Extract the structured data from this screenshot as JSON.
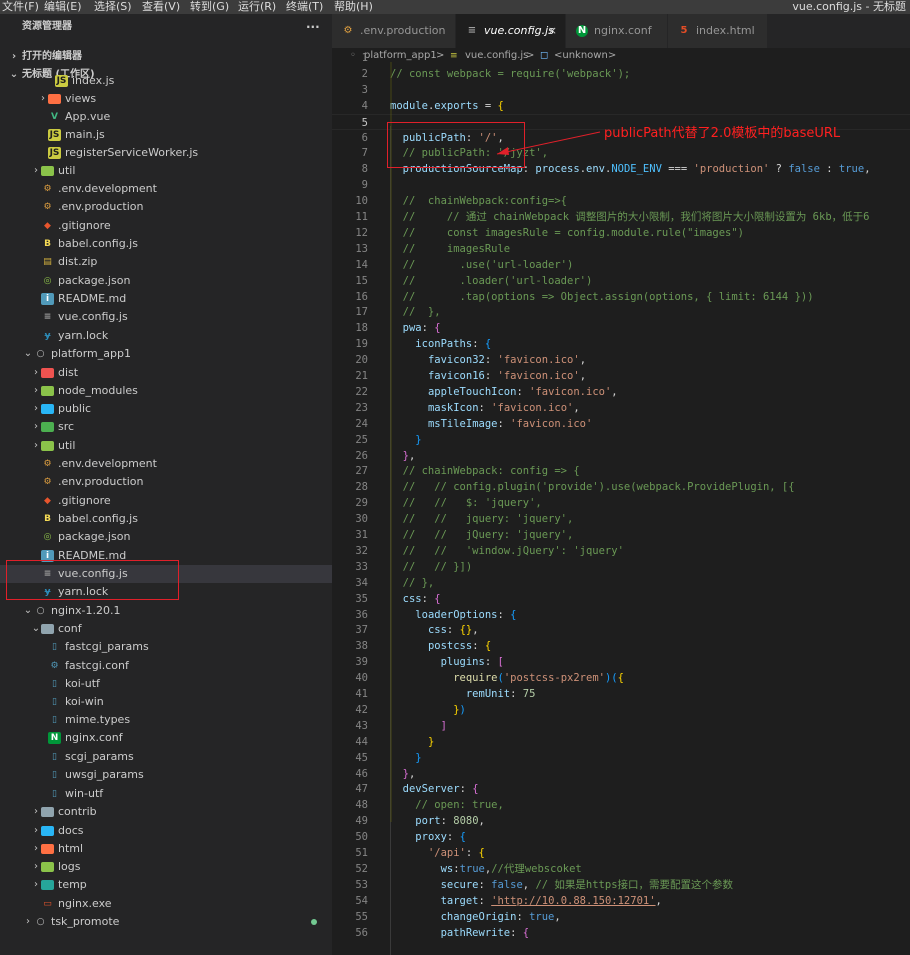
{
  "menu": [
    "文件(F)",
    "编辑(E)",
    "选择(S)",
    "查看(V)",
    "转到(G)",
    "运行(R)",
    "终端(T)",
    "帮助(H)"
  ],
  "window_title": "vue.config.js - 无标题",
  "sidebar": {
    "title": "资源管理器",
    "more": "···",
    "open_editors": "打开的编辑器",
    "workspace": "无标题 (工作区)"
  },
  "tree": [
    {
      "label": "index.js",
      "icon": "js",
      "depth": 4
    },
    {
      "label": "views",
      "icon": "folder-views",
      "depth": 3,
      "twisty": "closed"
    },
    {
      "label": "App.vue",
      "icon": "vue",
      "depth": 3
    },
    {
      "label": "main.js",
      "icon": "js",
      "depth": 3
    },
    {
      "label": "registerServiceWorker.js",
      "icon": "js",
      "depth": 3
    },
    {
      "label": "util",
      "icon": "folder-util",
      "depth": 2,
      "twisty": "closed"
    },
    {
      "label": ".env.development",
      "icon": "env",
      "depth": 2
    },
    {
      "label": ".env.production",
      "icon": "env",
      "depth": 2
    },
    {
      "label": ".gitignore",
      "icon": "git",
      "depth": 2
    },
    {
      "label": "babel.config.js",
      "icon": "babel",
      "depth": 2
    },
    {
      "label": "dist.zip",
      "icon": "zip",
      "depth": 2
    },
    {
      "label": "package.json",
      "icon": "npm",
      "depth": 2
    },
    {
      "label": "README.md",
      "icon": "info",
      "depth": 2
    },
    {
      "label": "vue.config.js",
      "icon": "config",
      "depth": 2
    },
    {
      "label": "yarn.lock",
      "icon": "yarn",
      "depth": 2
    },
    {
      "label": "platform_app1",
      "icon": "root",
      "depth": 1,
      "twisty": "open"
    },
    {
      "label": "dist",
      "icon": "folder-dist",
      "depth": 2,
      "twisty": "closed"
    },
    {
      "label": "node_modules",
      "icon": "folder-node",
      "depth": 2,
      "twisty": "closed"
    },
    {
      "label": "public",
      "icon": "folder-public",
      "depth": 2,
      "twisty": "closed"
    },
    {
      "label": "src",
      "icon": "folder-src",
      "depth": 2,
      "twisty": "closed"
    },
    {
      "label": "util",
      "icon": "folder-util",
      "depth": 2,
      "twisty": "closed"
    },
    {
      "label": ".env.development",
      "icon": "env",
      "depth": 2
    },
    {
      "label": ".env.production",
      "icon": "env",
      "depth": 2
    },
    {
      "label": ".gitignore",
      "icon": "git",
      "depth": 2
    },
    {
      "label": "babel.config.js",
      "icon": "babel",
      "depth": 2
    },
    {
      "label": "package.json",
      "icon": "npm",
      "depth": 2
    },
    {
      "label": "README.md",
      "icon": "info",
      "depth": 2
    },
    {
      "label": "vue.config.js",
      "icon": "config",
      "depth": 2,
      "selected": true
    },
    {
      "label": "yarn.lock",
      "icon": "yarn",
      "depth": 2
    },
    {
      "label": "nginx-1.20.1",
      "icon": "root",
      "depth": 1,
      "twisty": "open"
    },
    {
      "label": "conf",
      "icon": "folder-open",
      "depth": 2,
      "twisty": "open"
    },
    {
      "label": "fastcgi_params",
      "icon": "file",
      "depth": 3
    },
    {
      "label": "fastcgi.conf",
      "icon": "gear",
      "depth": 3
    },
    {
      "label": "koi-utf",
      "icon": "file",
      "depth": 3
    },
    {
      "label": "koi-win",
      "icon": "file",
      "depth": 3
    },
    {
      "label": "mime.types",
      "icon": "file",
      "depth": 3
    },
    {
      "label": "nginx.conf",
      "icon": "nginx",
      "depth": 3
    },
    {
      "label": "scgi_params",
      "icon": "file",
      "depth": 3
    },
    {
      "label": "uwsgi_params",
      "icon": "file",
      "depth": 3
    },
    {
      "label": "win-utf",
      "icon": "file",
      "depth": 3
    },
    {
      "label": "contrib",
      "icon": "folder",
      "depth": 2,
      "twisty": "closed"
    },
    {
      "label": "docs",
      "icon": "folder-docs",
      "depth": 2,
      "twisty": "closed"
    },
    {
      "label": "html",
      "icon": "folder-html",
      "depth": 2,
      "twisty": "closed"
    },
    {
      "label": "logs",
      "icon": "folder-logs",
      "depth": 2,
      "twisty": "closed"
    },
    {
      "label": "temp",
      "icon": "folder-temp",
      "depth": 2,
      "twisty": "closed"
    },
    {
      "label": "nginx.exe",
      "icon": "exe",
      "depth": 2
    },
    {
      "label": "tsk_promote",
      "icon": "root",
      "depth": 1,
      "twisty": "closed",
      "dot": true
    }
  ],
  "tabs": [
    {
      "label": ".env.production",
      "icon": "env",
      "active": false
    },
    {
      "label": "vue.config.js",
      "icon": "config",
      "active": true,
      "close": "×"
    },
    {
      "label": "nginx.conf",
      "icon": "nginx",
      "active": false
    },
    {
      "label": "index.html",
      "icon": "html",
      "active": false
    }
  ],
  "breadcrumb": {
    "folder": "platform_app1",
    "sep": ">",
    "file": "vue.config.js",
    "symbol": "<unknown>"
  },
  "annotation": "publicPath代替了2.0模板中的baseURL",
  "code": [
    [],
    [
      [
        "cm",
        "// const webpack = require('webpack');"
      ]
    ],
    [],
    [
      [
        "pr",
        "module"
      ],
      [
        "ops",
        "."
      ],
      [
        "pr",
        "exports"
      ],
      [
        "ops",
        " = "
      ],
      [
        "br",
        "{"
      ]
    ],
    [],
    [
      [
        "ops",
        "  "
      ],
      [
        "pr",
        "publicPath"
      ],
      [
        "ops",
        ": "
      ],
      [
        "st",
        "'/'"
      ],
      [
        "ops",
        ","
      ]
    ],
    [
      [
        "cm",
        "  // publicPath: '/jyzt',"
      ]
    ],
    [
      [
        "ops",
        "  "
      ],
      [
        "pr",
        "productionSourceMap"
      ],
      [
        "ops",
        ": "
      ],
      [
        "pr",
        "process"
      ],
      [
        "ops",
        "."
      ],
      [
        "pr",
        "env"
      ],
      [
        "ops",
        "."
      ],
      [
        "ct2",
        "NODE_ENV"
      ],
      [
        "ops",
        " === "
      ],
      [
        "st",
        "'production'"
      ],
      [
        "ops",
        " ? "
      ],
      [
        "kw",
        "false"
      ],
      [
        "ops",
        " : "
      ],
      [
        "kw",
        "true"
      ],
      [
        "ops",
        ","
      ]
    ],
    [],
    [
      [
        "cm",
        "  //  chainWebpack:config=>{"
      ]
    ],
    [
      [
        "cm",
        "  //     // 通过 chainWebpack 调整图片的大小限制，我们将图片大小限制设置为 6kb，低于6"
      ]
    ],
    [
      [
        "cm",
        "  //     const imagesRule = config.module.rule(\"images\")"
      ]
    ],
    [
      [
        "cm",
        "  //     imagesRule"
      ]
    ],
    [
      [
        "cm",
        "  //       .use('url-loader')"
      ]
    ],
    [
      [
        "cm",
        "  //       .loader('url-loader')"
      ]
    ],
    [
      [
        "cm",
        "  //       .tap(options => Object.assign(options, { limit: 6144 }))"
      ]
    ],
    [
      [
        "cm",
        "  //  },"
      ]
    ],
    [
      [
        "ops",
        "  "
      ],
      [
        "pr",
        "pwa"
      ],
      [
        "ops",
        ": "
      ],
      [
        "br2",
        "{"
      ]
    ],
    [
      [
        "ops",
        "    "
      ],
      [
        "pr",
        "iconPaths"
      ],
      [
        "ops",
        ": "
      ],
      [
        "br3",
        "{"
      ]
    ],
    [
      [
        "ops",
        "      "
      ],
      [
        "pr",
        "favicon32"
      ],
      [
        "ops",
        ": "
      ],
      [
        "st",
        "'favicon.ico'"
      ],
      [
        "ops",
        ","
      ]
    ],
    [
      [
        "ops",
        "      "
      ],
      [
        "pr",
        "favicon16"
      ],
      [
        "ops",
        ": "
      ],
      [
        "st",
        "'favicon.ico'"
      ],
      [
        "ops",
        ","
      ]
    ],
    [
      [
        "ops",
        "      "
      ],
      [
        "pr",
        "appleTouchIcon"
      ],
      [
        "ops",
        ": "
      ],
      [
        "st",
        "'favicon.ico'"
      ],
      [
        "ops",
        ","
      ]
    ],
    [
      [
        "ops",
        "      "
      ],
      [
        "pr",
        "maskIcon"
      ],
      [
        "ops",
        ": "
      ],
      [
        "st",
        "'favicon.ico'"
      ],
      [
        "ops",
        ","
      ]
    ],
    [
      [
        "ops",
        "      "
      ],
      [
        "pr",
        "msTileImage"
      ],
      [
        "ops",
        ": "
      ],
      [
        "st",
        "'favicon.ico'"
      ]
    ],
    [
      [
        "ops",
        "    "
      ],
      [
        "br3",
        "}"
      ]
    ],
    [
      [
        "ops",
        "  "
      ],
      [
        "br2",
        "}"
      ],
      [
        "ops",
        ","
      ]
    ],
    [
      [
        "cm",
        "  // chainWebpack: config => {"
      ]
    ],
    [
      [
        "cm",
        "  //   // config.plugin('provide').use(webpack.ProvidePlugin, [{"
      ]
    ],
    [
      [
        "cm",
        "  //   //   $: 'jquery',"
      ]
    ],
    [
      [
        "cm",
        "  //   //   jquery: 'jquery',"
      ]
    ],
    [
      [
        "cm",
        "  //   //   jQuery: 'jquery',"
      ]
    ],
    [
      [
        "cm",
        "  //   //   'window.jQuery': 'jquery'"
      ]
    ],
    [
      [
        "cm",
        "  //   // }])"
      ]
    ],
    [
      [
        "cm",
        "  // },"
      ]
    ],
    [
      [
        "ops",
        "  "
      ],
      [
        "pr",
        "css"
      ],
      [
        "ops",
        ": "
      ],
      [
        "br2",
        "{"
      ]
    ],
    [
      [
        "ops",
        "    "
      ],
      [
        "pr",
        "loaderOptions"
      ],
      [
        "ops",
        ": "
      ],
      [
        "br3",
        "{"
      ]
    ],
    [
      [
        "ops",
        "      "
      ],
      [
        "pr",
        "css"
      ],
      [
        "ops",
        ": "
      ],
      [
        "br",
        "{}"
      ],
      [
        "ops",
        ","
      ]
    ],
    [
      [
        "ops",
        "      "
      ],
      [
        "pr",
        "postcss"
      ],
      [
        "ops",
        ": "
      ],
      [
        "br",
        "{"
      ]
    ],
    [
      [
        "ops",
        "        "
      ],
      [
        "pr",
        "plugins"
      ],
      [
        "ops",
        ": "
      ],
      [
        "br2",
        "["
      ]
    ],
    [
      [
        "ops",
        "          "
      ],
      [
        "fn",
        "require"
      ],
      [
        "br3",
        "("
      ],
      [
        "st",
        "'postcss-px2rem'"
      ],
      [
        "br3",
        ")"
      ],
      [
        "br3",
        "("
      ],
      [
        "br",
        "{"
      ]
    ],
    [
      [
        "ops",
        "            "
      ],
      [
        "pr",
        "remUnit"
      ],
      [
        "ops",
        ": "
      ],
      [
        "nm",
        "75"
      ]
    ],
    [
      [
        "ops",
        "          "
      ],
      [
        "br",
        "}"
      ],
      [
        "br3",
        ")"
      ]
    ],
    [
      [
        "ops",
        "        "
      ],
      [
        "br2",
        "]"
      ]
    ],
    [
      [
        "ops",
        "      "
      ],
      [
        "br",
        "}"
      ]
    ],
    [
      [
        "ops",
        "    "
      ],
      [
        "br3",
        "}"
      ]
    ],
    [
      [
        "ops",
        "  "
      ],
      [
        "br2",
        "}"
      ],
      [
        "ops",
        ","
      ]
    ],
    [
      [
        "ops",
        "  "
      ],
      [
        "pr",
        "devServer"
      ],
      [
        "ops",
        ": "
      ],
      [
        "br2",
        "{"
      ]
    ],
    [
      [
        "cm",
        "    // open: true,"
      ]
    ],
    [
      [
        "ops",
        "    "
      ],
      [
        "pr",
        "port"
      ],
      [
        "ops",
        ": "
      ],
      [
        "nm",
        "8080"
      ],
      [
        "ops",
        ","
      ]
    ],
    [
      [
        "ops",
        "    "
      ],
      [
        "pr",
        "proxy"
      ],
      [
        "ops",
        ": "
      ],
      [
        "br3",
        "{"
      ]
    ],
    [
      [
        "ops",
        "      "
      ],
      [
        "st",
        "'/api'"
      ],
      [
        "ops",
        ": "
      ],
      [
        "br",
        "{"
      ]
    ],
    [
      [
        "ops",
        "        "
      ],
      [
        "pr",
        "ws"
      ],
      [
        "ops",
        ":"
      ],
      [
        "kw",
        "true"
      ],
      [
        "ops",
        ","
      ],
      [
        "cm",
        "//代理webscoket"
      ]
    ],
    [
      [
        "ops",
        "        "
      ],
      [
        "pr",
        "secure"
      ],
      [
        "ops",
        ": "
      ],
      [
        "kw",
        "false"
      ],
      [
        "ops",
        ", "
      ],
      [
        "cm",
        "// 如果是https接口，需要配置这个参数"
      ]
    ],
    [
      [
        "ops",
        "        "
      ],
      [
        "pr",
        "target"
      ],
      [
        "ops",
        ": "
      ],
      [
        "rst",
        "'http://10.0.88.150:12701'"
      ],
      [
        "ops",
        ","
      ]
    ],
    [
      [
        "ops",
        "        "
      ],
      [
        "pr",
        "changeOrigin"
      ],
      [
        "ops",
        ": "
      ],
      [
        "kw",
        "true"
      ],
      [
        "ops",
        ","
      ]
    ],
    [
      [
        "ops",
        "        "
      ],
      [
        "pr",
        "pathRewrite"
      ],
      [
        "ops",
        ": "
      ],
      [
        "br2",
        "{"
      ]
    ]
  ]
}
